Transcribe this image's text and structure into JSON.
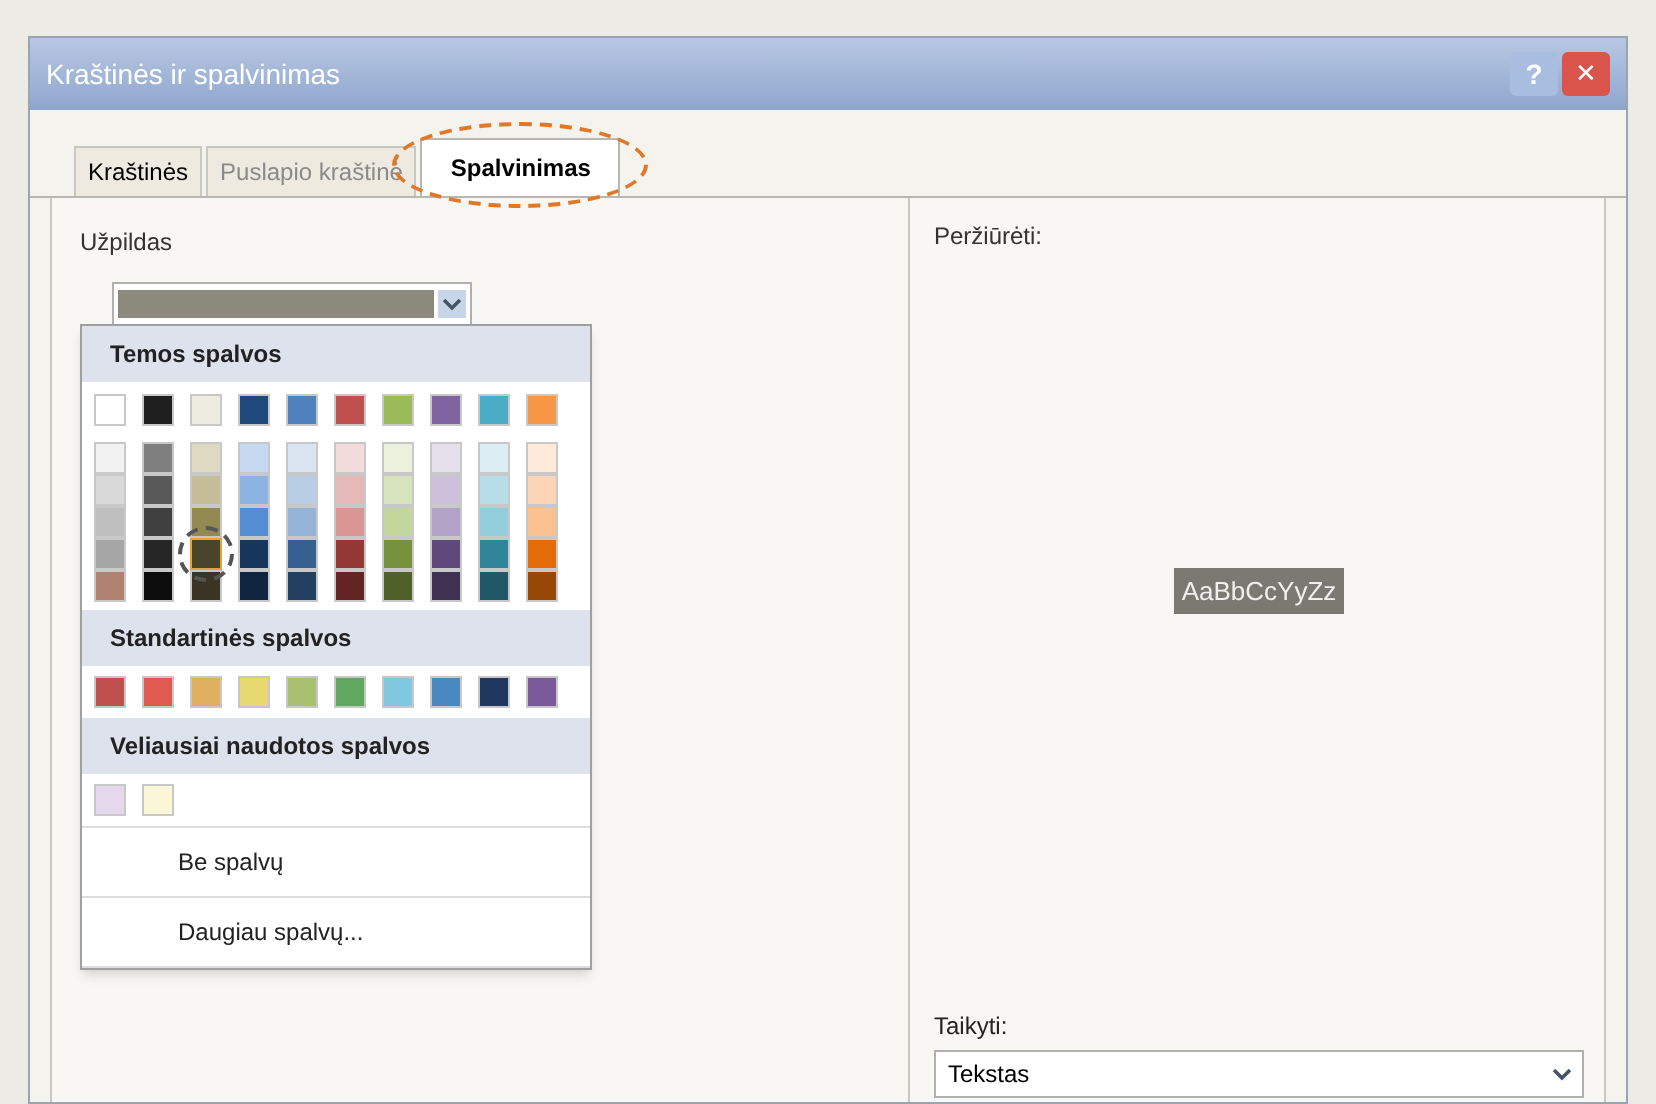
{
  "window": {
    "title": "Kraštinės ir spalvinimas",
    "buttons": [
      {
        "kind": "help",
        "label": "?"
      },
      {
        "kind": "close",
        "label": "✕"
      }
    ]
  },
  "tabs": [
    {
      "label": "Kraštinės",
      "selected": false,
      "disabled": false
    },
    {
      "label": "Puslapio kraštinė",
      "selected": false,
      "disabled": true
    },
    {
      "label": "Spalvinimas",
      "selected": true,
      "disabled": false
    }
  ],
  "fill": {
    "label": "Užpildas"
  },
  "color_menu": {
    "theme_heading": "Temos spalvos",
    "theme_colors": [
      {
        "color": "#ffffff",
        "shades": [
          {
            "color": "#f2f2f2",
            "selected": false
          },
          {
            "color": "#d9d9d9",
            "selected": false
          },
          {
            "color": "#bfbfbf",
            "selected": false
          },
          {
            "color": "#a6a6a6",
            "selected": false
          },
          {
            "color": "#b08070",
            "selected": false
          }
        ]
      },
      {
        "color": "#1f1f1f",
        "shades": [
          {
            "color": "#7f7f7f",
            "selected": false
          },
          {
            "color": "#595959",
            "selected": false
          },
          {
            "color": "#3f3f3f",
            "selected": false
          },
          {
            "color": "#262626",
            "selected": false
          },
          {
            "color": "#0d0d0d",
            "selected": false
          }
        ]
      },
      {
        "color": "#eeece1",
        "shades": [
          {
            "color": "#ddd9c3",
            "selected": false
          },
          {
            "color": "#c4bd97",
            "selected": false
          },
          {
            "color": "#938953",
            "selected": false
          },
          {
            "color": "#4a452a",
            "selected": true
          },
          {
            "color": "#3a3522",
            "selected": false
          }
        ]
      },
      {
        "color": "#1f497d",
        "shades": [
          {
            "color": "#c6d9f0",
            "selected": false
          },
          {
            "color": "#8db3e2",
            "selected": false
          },
          {
            "color": "#548dd4",
            "selected": false
          },
          {
            "color": "#17365d",
            "selected": false
          },
          {
            "color": "#0f243e",
            "selected": false
          }
        ]
      },
      {
        "color": "#4f81bd",
        "shades": [
          {
            "color": "#dbe5f1",
            "selected": false
          },
          {
            "color": "#b8cce4",
            "selected": false
          },
          {
            "color": "#95b3d7",
            "selected": false
          },
          {
            "color": "#366092",
            "selected": false
          },
          {
            "color": "#244061",
            "selected": false
          }
        ]
      },
      {
        "color": "#c0504d",
        "shades": [
          {
            "color": "#f2dcdb",
            "selected": false
          },
          {
            "color": "#e5b9b7",
            "selected": false
          },
          {
            "color": "#d99694",
            "selected": false
          },
          {
            "color": "#953734",
            "selected": false
          },
          {
            "color": "#632423",
            "selected": false
          }
        ]
      },
      {
        "color": "#9bbb59",
        "shades": [
          {
            "color": "#ebf1dd",
            "selected": false
          },
          {
            "color": "#d7e3bc",
            "selected": false
          },
          {
            "color": "#c3d69b",
            "selected": false
          },
          {
            "color": "#76923c",
            "selected": false
          },
          {
            "color": "#4f6128",
            "selected": false
          }
        ]
      },
      {
        "color": "#8064a2",
        "shades": [
          {
            "color": "#e5e0ec",
            "selected": false
          },
          {
            "color": "#ccc1d9",
            "selected": false
          },
          {
            "color": "#b2a2c7",
            "selected": false
          },
          {
            "color": "#5f497a",
            "selected": false
          },
          {
            "color": "#3f3151",
            "selected": false
          }
        ]
      },
      {
        "color": "#4bacc6",
        "shades": [
          {
            "color": "#dbeef3",
            "selected": false
          },
          {
            "color": "#b7dde8",
            "selected": false
          },
          {
            "color": "#92cddc",
            "selected": false
          },
          {
            "color": "#31859b",
            "selected": false
          },
          {
            "color": "#205867",
            "selected": false
          }
        ]
      },
      {
        "color": "#f79646",
        "shades": [
          {
            "color": "#fdeada",
            "selected": false
          },
          {
            "color": "#fbd5b5",
            "selected": false
          },
          {
            "color": "#fac08f",
            "selected": false
          },
          {
            "color": "#e36c09",
            "selected": false
          },
          {
            "color": "#974806",
            "selected": false
          }
        ]
      }
    ],
    "standard_heading": "Standartinės spalvos",
    "standard_colors": [
      {
        "color": "#c0504d"
      },
      {
        "color": "#e05a4f"
      },
      {
        "color": "#e0b060"
      },
      {
        "color": "#e8d870"
      },
      {
        "color": "#a8c070"
      },
      {
        "color": "#60a860"
      },
      {
        "color": "#80c8e0"
      },
      {
        "color": "#4a88c0"
      },
      {
        "color": "#203860"
      },
      {
        "color": "#7a5a9a"
      }
    ],
    "recent_heading": "Veliausiai naudotos spalvos",
    "recent_colors": [
      {
        "color": "#e5d8ec"
      },
      {
        "color": "#fbf6d8"
      }
    ],
    "items": [
      {
        "label": "Be spalvų"
      },
      {
        "label": "Daugiau spalvų..."
      }
    ]
  },
  "preview": {
    "label": "Peržiūrėti:",
    "sample": "AaBbCcYyZz"
  },
  "apply": {
    "label": "Taikyti:",
    "value": "Tekstas"
  }
}
